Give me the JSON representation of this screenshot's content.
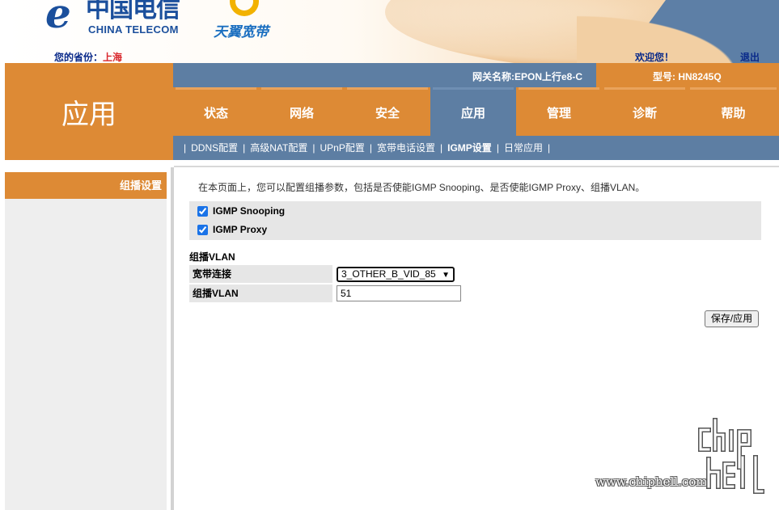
{
  "header": {
    "logo_glyph": "e",
    "logo_cn": "中国电信",
    "logo_en": "CHINA TELECOM",
    "product_logo": "天翼宽带",
    "province_label": "您的省份：",
    "province_value": "上海",
    "welcome": "欢迎您！",
    "logout": "退出"
  },
  "section_title": "应用",
  "infobar": {
    "gateway": "网关名称:EPON上行e8-C",
    "model": "型号: HN8245Q"
  },
  "tabs": [
    {
      "label": "状态"
    },
    {
      "label": "网络"
    },
    {
      "label": "安全"
    },
    {
      "label": "应用",
      "active": true
    },
    {
      "label": "管理"
    },
    {
      "label": "诊断"
    },
    {
      "label": "帮助"
    }
  ],
  "submenu": [
    {
      "label": "DDNS配置"
    },
    {
      "label": "高级NAT配置"
    },
    {
      "label": "UPnP配置"
    },
    {
      "label": "宽带电话设置"
    },
    {
      "label": "IGMP设置",
      "current": true
    },
    {
      "label": "日常应用"
    }
  ],
  "sidebar": {
    "heading": "组播设置"
  },
  "content": {
    "intro": "在本页面上，您可以配置组播参数，包括是否使能IGMP Snooping、是否使能IGMP Proxy、组播VLAN。",
    "igmp_snooping": {
      "label": "IGMP Snooping",
      "checked": true
    },
    "igmp_proxy": {
      "label": "IGMP Proxy",
      "checked": true
    },
    "vlan_section_title": "组播VLAN",
    "wan_label": "宽带连接",
    "wan_value": "3_OTHER_B_VID_85",
    "vlan_label": "组播VLAN",
    "vlan_value": "51",
    "save_button": "保存/应用"
  },
  "watermark": {
    "url": "www.chiphell.com",
    "logo_text": "chip hell"
  },
  "colors": {
    "orange": "#dd8a35",
    "steel_blue": "#5d7ea3",
    "panel_gray": "#e6e6e6",
    "brand_blue": "#1b4f9c"
  }
}
